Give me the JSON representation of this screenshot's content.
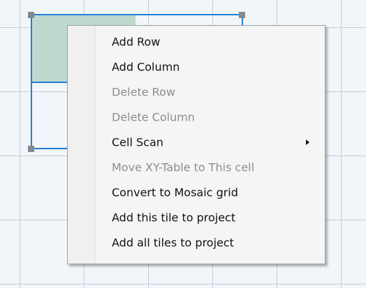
{
  "context_menu": {
    "items": [
      {
        "label": "Add Row",
        "enabled": true
      },
      {
        "label": "Add Column",
        "enabled": true
      },
      {
        "label": "Delete Row",
        "enabled": false
      },
      {
        "label": "Delete Column",
        "enabled": false
      },
      {
        "label": "Cell Scan",
        "enabled": true,
        "submenu": true
      },
      {
        "label": "Move XY-Table to This cell",
        "enabled": false
      },
      {
        "label": "Convert to Mosaic grid",
        "enabled": true
      },
      {
        "label": "Add this tile to project",
        "enabled": true
      },
      {
        "label": "Add all tiles to project",
        "enabled": true
      }
    ]
  },
  "colors": {
    "selection": "#1e7fd6",
    "tile_fill": "#bfd8cf",
    "grid": "#c4ccd6",
    "disabled_text": "#8d8d8d"
  }
}
